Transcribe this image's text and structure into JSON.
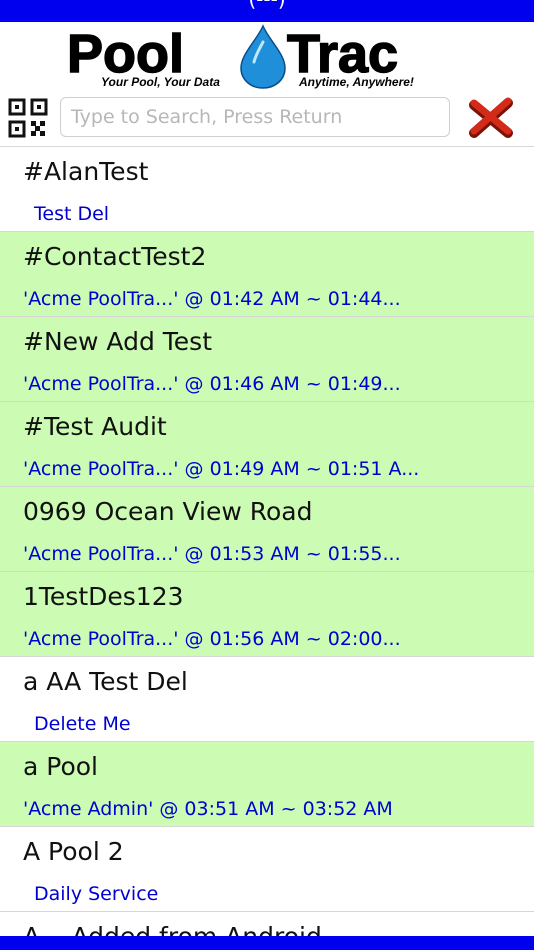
{
  "status_bar": {
    "text": "(---)"
  },
  "header": {
    "logo_text_left": "Pool",
    "logo_text_right": "Trac",
    "tagline_left": "Your Pool, Your Data",
    "tagline_right": "Anytime, Anywhere!"
  },
  "search": {
    "placeholder": "Type to Search, Press Return",
    "value": ""
  },
  "icons": {
    "qr": "qr-code-icon",
    "clear": "red-x-icon"
  },
  "colors": {
    "bar_blue": "#0000ee",
    "highlight_green": "#ccfcb4",
    "link_blue": "#0000d0",
    "clear_red": "#d42a1a"
  },
  "pools": [
    {
      "name": "#AlanTest",
      "detail": "Test Del",
      "highlighted": false
    },
    {
      "name": "#ContactTest2",
      "detail": "'Acme PoolTra...' @ 01:42 AM ~ 01:44...",
      "highlighted": true
    },
    {
      "name": "#New Add Test",
      "detail": "'Acme PoolTra...' @ 01:46 AM ~ 01:49...",
      "highlighted": true
    },
    {
      "name": "#Test Audit",
      "detail": "'Acme PoolTra...' @ 01:49 AM ~ 01:51 A...",
      "highlighted": true
    },
    {
      "name": "0969 Ocean View Road",
      "detail": "'Acme PoolTra...' @ 01:53 AM ~ 01:55...",
      "highlighted": true
    },
    {
      "name": "1TestDes123",
      "detail": "'Acme PoolTra...' @ 01:56 AM ~ 02:00...",
      "highlighted": true
    },
    {
      "name": "a AA Test Del",
      "detail": "Delete Me",
      "highlighted": false
    },
    {
      "name": "a Pool",
      "detail": "'Acme Admin' @ 03:51 AM ~ 03:52 AM",
      "highlighted": true
    },
    {
      "name": "A Pool 2",
      "detail": "Daily Service",
      "highlighted": false
    },
    {
      "name": "A... Added from Android",
      "detail": "",
      "highlighted": false
    }
  ]
}
